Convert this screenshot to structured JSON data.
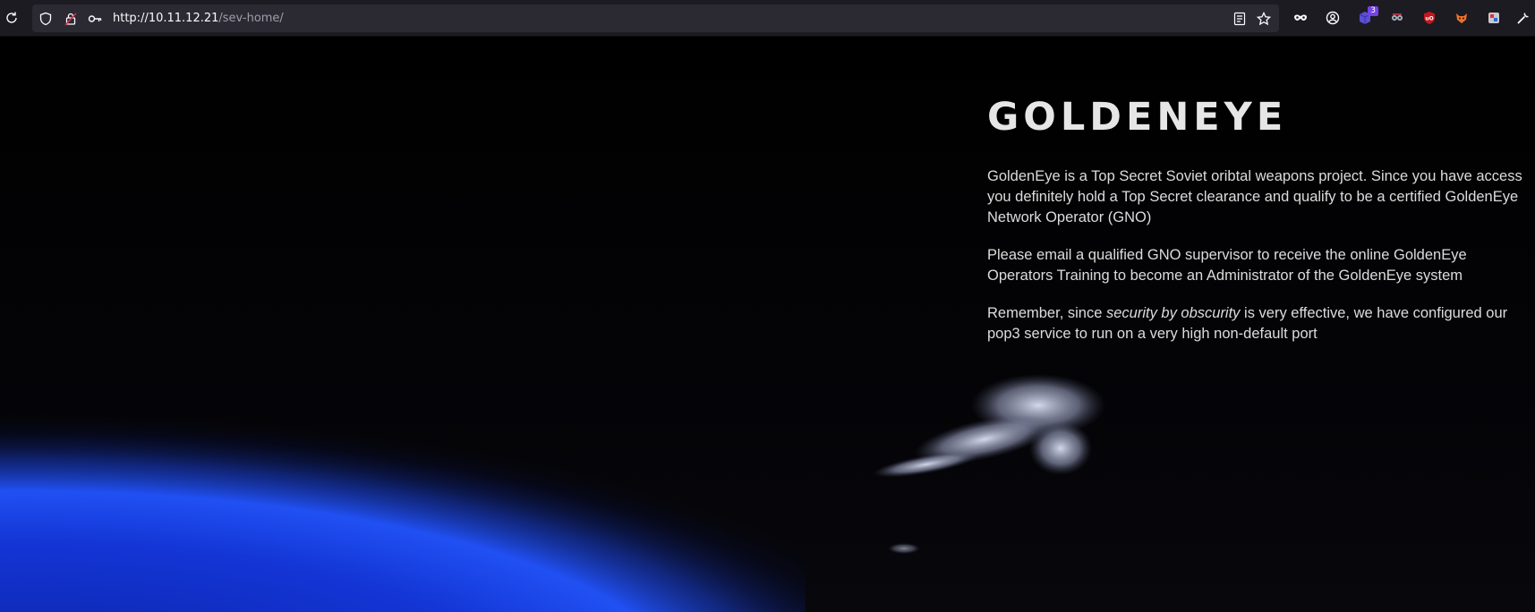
{
  "browser": {
    "url_host": "http://10.11.12.21",
    "url_path": "/sev-home/",
    "extension_badge_count": "3",
    "icons": [
      "reload-icon",
      "shield-icon",
      "lock-icon",
      "key-icon",
      "reader-view-icon",
      "bookmark-star-icon",
      "incognito-mask-icon",
      "account-icon",
      "extension-icon",
      "extension-icon",
      "ublock-icon",
      "foxyproxy-icon",
      "extension-icon",
      "wrench-icon"
    ]
  },
  "page": {
    "title": "GOLDENEYE",
    "paragraph1": "GoldenEye is a Top Secret Soviet oribtal weapons project. Since you have access you definitely hold a Top Secret clearance and qualify to be a certified GoldenEye Network Operator (GNO)",
    "paragraph2": "Please email a qualified GNO supervisor to receive the online GoldenEye Operators Training to become an Administrator of the GoldenEye system",
    "paragraph3_before": "Remember, since ",
    "paragraph3_emphasis": "security by obscurity",
    "paragraph3_after": " is very effective, we have configured our pop3 service to run on a very high non-default port"
  },
  "colors": {
    "toolbar_bg": "#1c1b22",
    "urlbar_bg": "#2b2a33",
    "page_bg": "#020203",
    "earth_glow": "#1e4cff",
    "text": "#dcdcdc"
  }
}
